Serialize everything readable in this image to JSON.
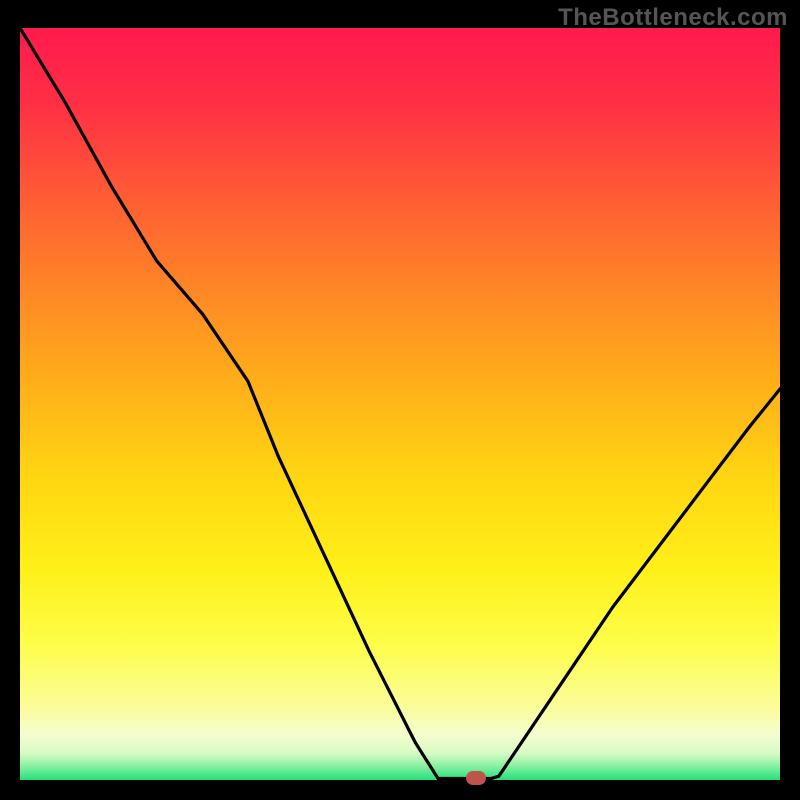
{
  "watermark": "TheBottleneck.com",
  "colors": {
    "background": "#000000",
    "marker": "#c0544d",
    "curve": "#000000",
    "watermark_text": "#555555"
  },
  "gradient_stops": [
    {
      "offset": 0.0,
      "color": "#ff1a4d"
    },
    {
      "offset": 0.1,
      "color": "#ff2f45"
    },
    {
      "offset": 0.22,
      "color": "#ff5a35"
    },
    {
      "offset": 0.35,
      "color": "#ff8726"
    },
    {
      "offset": 0.48,
      "color": "#ffb119"
    },
    {
      "offset": 0.6,
      "color": "#ffd612"
    },
    {
      "offset": 0.72,
      "color": "#fff018"
    },
    {
      "offset": 0.82,
      "color": "#fdfd4a"
    },
    {
      "offset": 0.9,
      "color": "#fbfd96"
    },
    {
      "offset": 0.94,
      "color": "#f5fdcf"
    },
    {
      "offset": 0.965,
      "color": "#d6fbc4"
    },
    {
      "offset": 0.98,
      "color": "#8ff2a3"
    },
    {
      "offset": 1.0,
      "color": "#24e07a"
    }
  ],
  "chart_data": {
    "type": "line",
    "title": "",
    "xlabel": "",
    "ylabel": "",
    "x": [
      0.0,
      0.06,
      0.12,
      0.18,
      0.24,
      0.3,
      0.34,
      0.4,
      0.46,
      0.52,
      0.55,
      0.57,
      0.585,
      0.62,
      0.63,
      0.66,
      0.72,
      0.78,
      0.84,
      0.9,
      0.96,
      1.0
    ],
    "y": [
      1.0,
      0.9,
      0.79,
      0.69,
      0.62,
      0.53,
      0.43,
      0.3,
      0.17,
      0.05,
      0.002,
      0.002,
      0.002,
      0.002,
      0.005,
      0.05,
      0.14,
      0.23,
      0.31,
      0.39,
      0.47,
      0.52
    ],
    "series_name": "bottleneck_curve",
    "xlim": [
      0,
      1
    ],
    "ylim": [
      0,
      1
    ],
    "marker": {
      "x": 0.6,
      "y": 0.002,
      "shape": "pill",
      "color": "#c0544d"
    },
    "notes": "Values are normalized (0-1) relative to the plotted area; they are visual estimates read from pixel positions since no axis ticks or numeric labels are present."
  }
}
